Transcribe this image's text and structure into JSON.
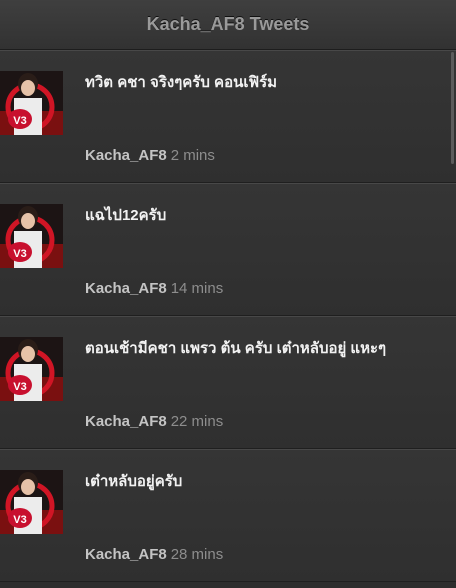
{
  "header": {
    "title": "Kacha_AF8 Tweets"
  },
  "tweets": [
    {
      "text": "ทวิต คชา จริงๆครับ คอนเฟิร์ม",
      "author": "Kacha_AF8",
      "time": "2 mins",
      "avatar_badge": "V3"
    },
    {
      "text": "แฉไป12ครับ",
      "author": "Kacha_AF8",
      "time": "14 mins",
      "avatar_badge": "V3"
    },
    {
      "text": "ตอนเช้ามีคชา แพรว ต้น ครับ เต๋าหลับอยู่ แหะๆ",
      "author": "Kacha_AF8",
      "time": "22 mins",
      "avatar_badge": "V3"
    },
    {
      "text": "เต๋าหลับอยู่ครับ",
      "author": "Kacha_AF8",
      "time": "28 mins",
      "avatar_badge": "V3"
    }
  ],
  "colors": {
    "background": "#2d2d2d",
    "header_text": "#9a9a9a",
    "tweet_text": "#f2f2f2",
    "author_text": "#c4c4c4",
    "avatar_accent": "#c8102e"
  }
}
